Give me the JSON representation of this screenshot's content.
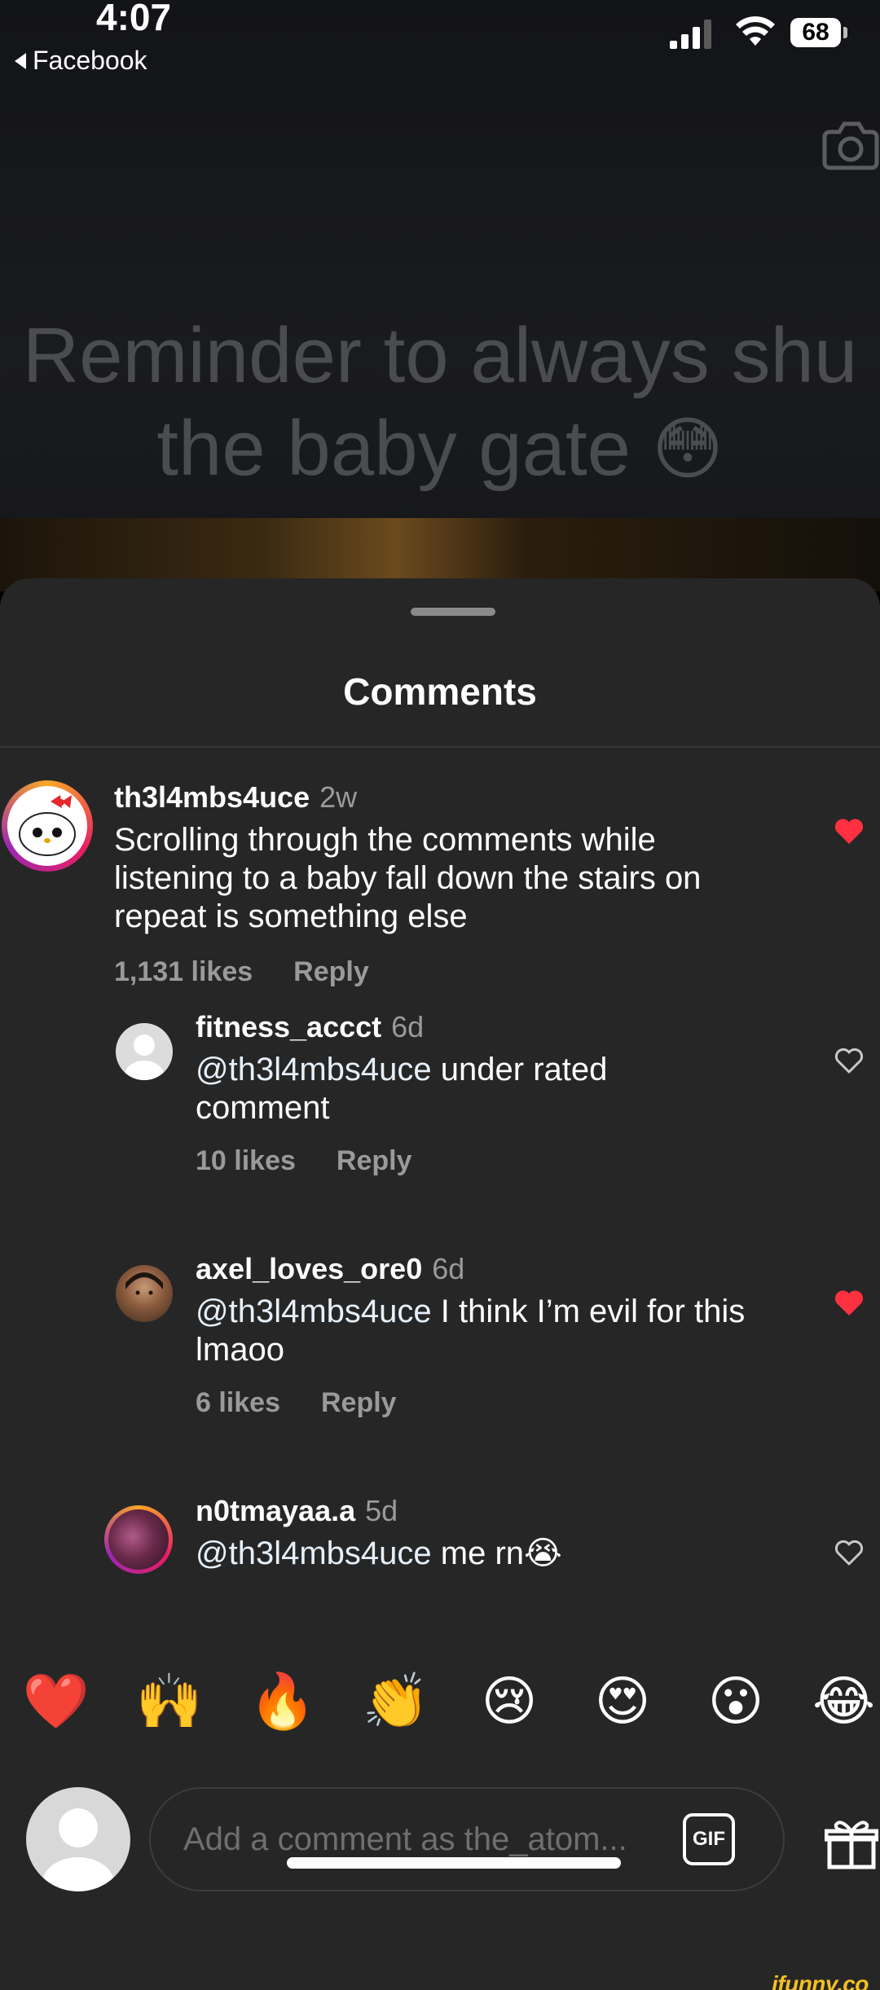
{
  "status_bar": {
    "time": "4:07",
    "back_label": "Facebook",
    "battery": "68"
  },
  "video": {
    "caption_line1": "Reminder to always shu",
    "caption_line2": "the baby gate",
    "caption_emoji": "😳"
  },
  "sheet": {
    "title": "Comments"
  },
  "comments": [
    {
      "username": "th3l4mbs4uce",
      "age": "2w",
      "mention": "",
      "text": "Scrolling through the comments while listening to a baby fall down the stairs on repeat is something else",
      "likes": "1,131 likes",
      "reply": "Reply",
      "liked": true
    },
    {
      "username": "fitness_accct",
      "age": "6d",
      "mention": "@th3l4mbs4uce",
      "text": " under rated comment",
      "likes": "10 likes",
      "reply": "Reply",
      "liked": false
    },
    {
      "username": "axel_loves_ore0",
      "age": "6d",
      "mention": "@th3l4mbs4uce",
      "text": " I think I’m evil for this lmaoo",
      "likes": "6 likes",
      "reply": "Reply",
      "liked": true
    },
    {
      "username": "n0tmayaa.a",
      "age": "5d",
      "mention": "@th3l4mbs4uce",
      "text": " me rn😭",
      "likes": "",
      "reply": "",
      "liked": false
    }
  ],
  "reactions": [
    "❤️",
    "🙌",
    "🔥",
    "👏",
    "😢",
    "😍",
    "😮",
    "😂"
  ],
  "composer": {
    "placeholder": "Add a comment as the_atom...",
    "gif_label": "GIF"
  },
  "watermark": "ifunny.co",
  "colors": {
    "sheet_bg": "#262626",
    "like_red": "#ff3040",
    "muted_text": "#9a9a9a"
  }
}
